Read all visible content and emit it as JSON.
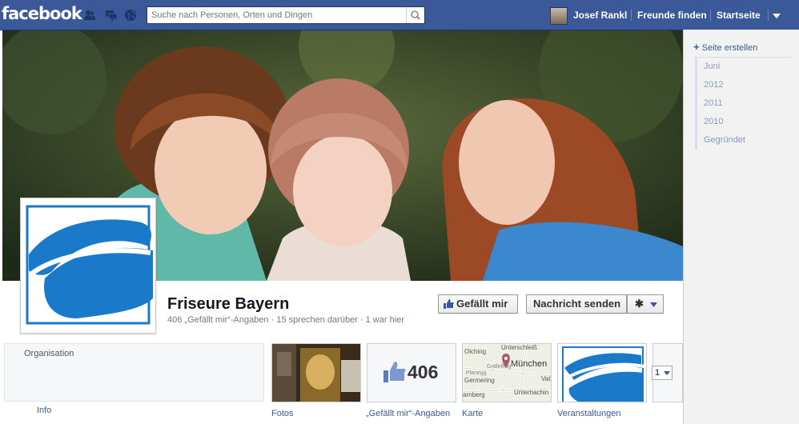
{
  "header": {
    "logo": "facebook",
    "search_placeholder": "Suche nach Personen, Orten und Dingen",
    "user_name": "Josef Rankl",
    "find_friends": "Freunde finden",
    "home": "Startseite"
  },
  "sidebar": {
    "create_page": "Seite erstellen",
    "timeline": [
      "Juni",
      "2012",
      "2011",
      "2010",
      "Gegründet"
    ]
  },
  "page": {
    "name": "Friseure Bayern",
    "stats": "406 „Gefällt mir“-Angaben · 15 sprechen darüber · 1 war hier",
    "like_button": "Gefällt mir",
    "message_button": "Nachricht senden",
    "category": "Organisation",
    "info_label": "Info"
  },
  "apps": {
    "photos": "Fotos",
    "likes_count": "406",
    "likes_label": "„Gefällt mir“-Angaben",
    "map_label": "Karte",
    "events_label": "Veranstaltungen",
    "more_count": "1",
    "map_places": [
      "Unterschleiß",
      "Olching",
      "München",
      "Vat",
      "Germering",
      "Unterhachin",
      "Planegg",
      "Gräfelfing",
      "arnberg"
    ]
  },
  "colors": {
    "brand": "#3b5998",
    "logo_blue": "#1a7ac9"
  }
}
